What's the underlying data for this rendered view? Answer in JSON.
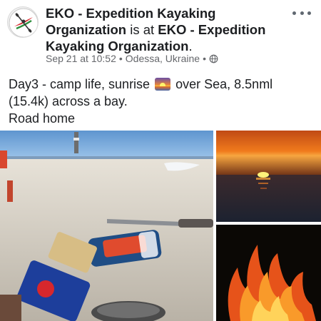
{
  "post": {
    "author": "EKO - Expedition Kayaking Organization",
    "connector": " is at ",
    "location_page": "EKO - Expedition Kayaking Organization",
    "period": ".",
    "date": "Sep 21 at 10:52",
    "separator": " • ",
    "place": "Odessa, Ukraine",
    "separator2": " •",
    "privacy_icon": "globe-icon",
    "more_icon": "more-options-icon",
    "text_line1_a": "Day3 - camp life, sunrise",
    "text_line1_b": "over Sea, 8.5nml",
    "text_line2": "(15.4k) across a bay.",
    "text_line3": "Road home",
    "emoji_icon": "sunrise-emoji-icon"
  },
  "photos": [
    {
      "name": "beach-camp-photo"
    },
    {
      "name": "sunrise-over-sea-photo"
    },
    {
      "name": "campfire-photo"
    }
  ],
  "colors": {
    "text": "#1c1e21",
    "meta": "#65676b",
    "sunset_orange": "#f07a1c",
    "sky_blue": "#7fb4e6"
  }
}
